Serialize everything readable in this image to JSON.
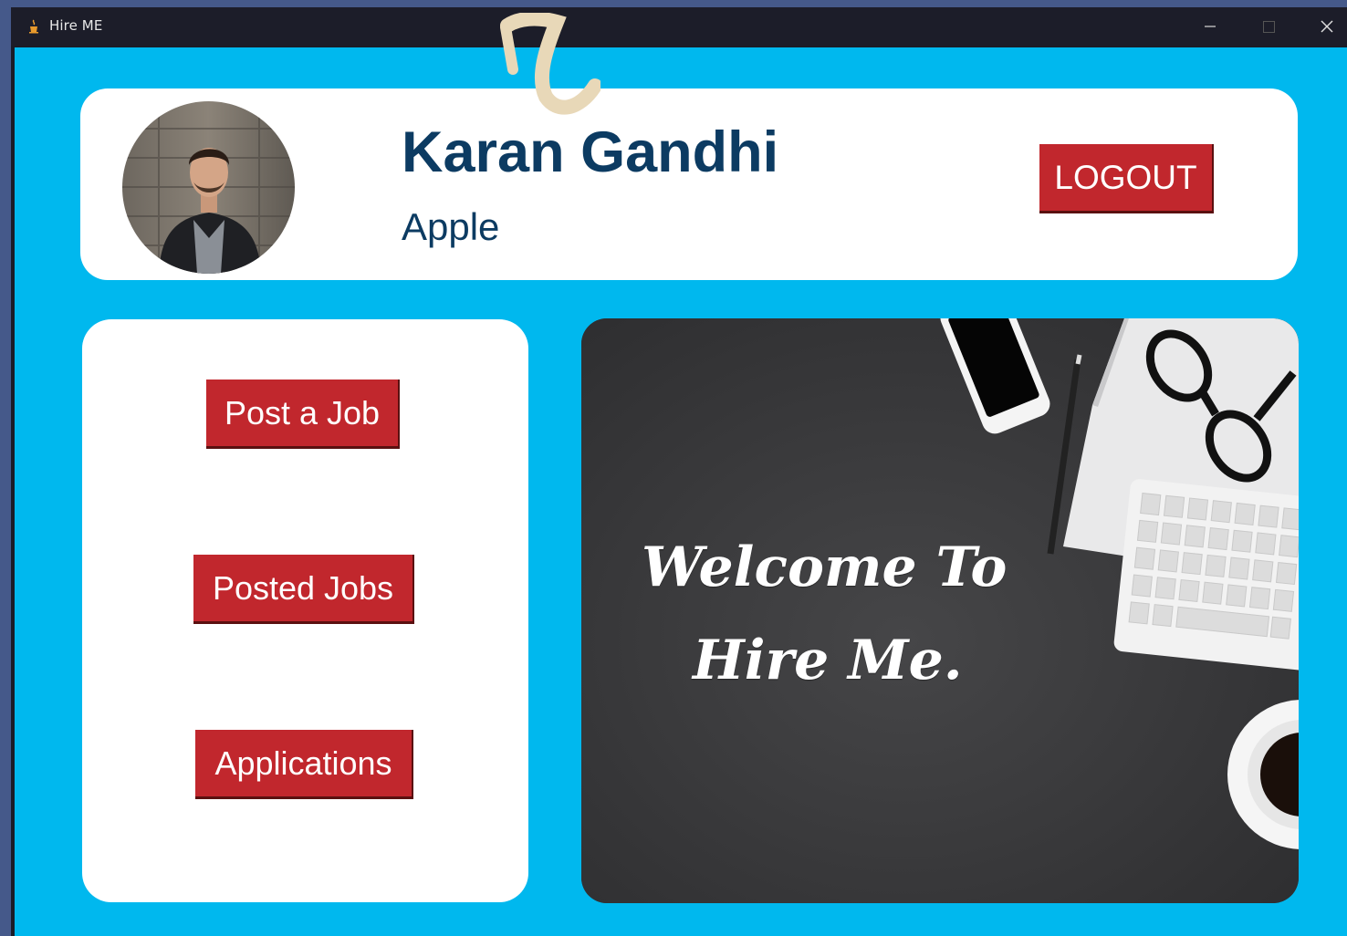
{
  "window": {
    "title": "Hire ME",
    "controls": {
      "minimize": "–",
      "maximize": "",
      "close": "✕"
    }
  },
  "profile": {
    "name": "Karan Gandhi",
    "company": "Apple",
    "logout_label": "LOGOUT",
    "avatar": "profile-photo"
  },
  "menu": {
    "items": [
      {
        "label": "Post a Job"
      },
      {
        "label": "Posted Jobs"
      },
      {
        "label": "Applications"
      }
    ]
  },
  "banner": {
    "line1": "Welcome To",
    "line2": "Hire Me."
  },
  "colors": {
    "background": "#00b8ee",
    "card": "#ffffff",
    "button": "#c1272d",
    "text_primary": "#0c3b62",
    "titlebar": "#1c1d29",
    "banner": "#3b3b3d"
  },
  "icons": {
    "app": "java-cup-icon",
    "minimize": "minimize-icon",
    "maximize": "maximize-icon",
    "close": "close-icon"
  }
}
